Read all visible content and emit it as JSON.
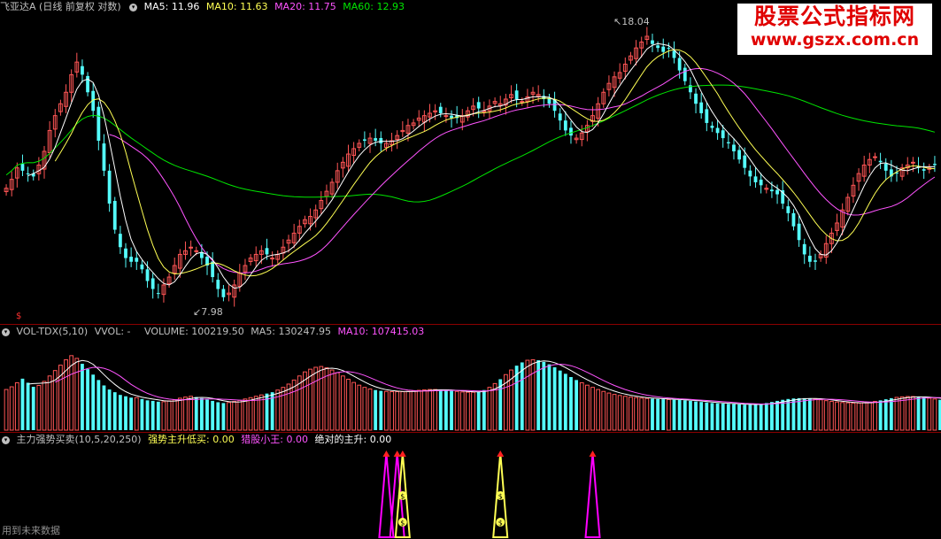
{
  "main": {
    "stock": "飞亚达A",
    "period": "(日线 前复权 对数)",
    "ma5": {
      "label": "MA5:",
      "value": "11.96",
      "color": "#ffffff"
    },
    "ma10": {
      "label": "MA10:",
      "value": "11.63",
      "color": "#ffff54"
    },
    "ma20": {
      "label": "MA20:",
      "value": "11.75",
      "color": "#ff54ff"
    },
    "ma60": {
      "label": "MA60:",
      "value": "12.93",
      "color": "#00e600"
    },
    "high_label": "18.04",
    "low_label": "7.98",
    "side_marker": "$"
  },
  "volume": {
    "name": "VOL-TDX(5,10)",
    "vvol": "VVOL: -",
    "vol": {
      "label": "VOLUME:",
      "value": "100219.50"
    },
    "ma5": {
      "label": "MA5:",
      "value": "130247.95"
    },
    "ma10": {
      "label": "MA10:",
      "value": "107415.03",
      "color": "#ff54ff"
    }
  },
  "indicator": {
    "name": "主力强势买卖(10,5,20,250)",
    "s1": {
      "label": "强势主升低买:",
      "value": "0.00",
      "color": "#ffff54"
    },
    "s2": {
      "label": "猎股小王:",
      "value": "0.00",
      "color": "#ff54ff"
    },
    "s3": {
      "label": "绝对的主升:",
      "value": "0.00",
      "color": "#ffffff"
    },
    "coin_glyph": "$"
  },
  "footer": "用到未来数据",
  "watermark": {
    "line1": "股票公式指标网",
    "line2": "www.gszx.com.cn"
  },
  "colors": {
    "up": "#ff5555",
    "down": "#54fcfc",
    "ma5": "#ffffff",
    "ma10": "#ffff54",
    "ma20": "#ff54ff",
    "ma60": "#00e600",
    "vma5": "#ffffff",
    "vma10": "#ff54ff",
    "signal_yellow": "#ffff54",
    "signal_magenta": "#ff00ff"
  },
  "chart_data": [
    {
      "type": "candlestick",
      "title": "飞亚达A (日线 前复权 对数)",
      "scale": "log",
      "ylim": [
        7.6,
        18.6
      ],
      "annotations": [
        {
          "text": "18.04",
          "value": 18.04,
          "index": 134
        },
        {
          "text": "7.98",
          "value": 7.98,
          "index": 41
        }
      ],
      "close": [
        11.2,
        11.5,
        11.9,
        11.8,
        11.7,
        11.6,
        12.0,
        12.5,
        13.3,
        13.9,
        14.4,
        14.9,
        15.7,
        16.3,
        15.7,
        14.9,
        14.1,
        12.9,
        11.8,
        10.7,
        9.9,
        9.4,
        9.1,
        9.0,
        9.0,
        8.8,
        8.5,
        8.3,
        8.2,
        8.4,
        8.6,
        8.9,
        9.2,
        9.3,
        9.4,
        9.3,
        9.1,
        8.9,
        8.6,
        8.3,
        8.1,
        8.2,
        8.4,
        8.7,
        8.9,
        9.1,
        9.2,
        9.3,
        9.2,
        9.1,
        9.2,
        9.4,
        9.6,
        9.8,
        10.0,
        10.2,
        10.3,
        10.5,
        10.8,
        11.1,
        11.4,
        11.8,
        12.1,
        12.4,
        12.6,
        12.8,
        12.9,
        13.0,
        12.9,
        12.8,
        12.8,
        12.9,
        13.1,
        13.3,
        13.5,
        13.6,
        13.8,
        13.9,
        14.0,
        14.1,
        14.0,
        13.9,
        13.8,
        13.8,
        13.9,
        14.1,
        14.3,
        14.2,
        14.1,
        14.3,
        14.5,
        14.4,
        14.6,
        14.8,
        14.6,
        14.5,
        14.7,
        14.9,
        14.8,
        14.6,
        14.4,
        14.1,
        13.7,
        13.3,
        13.1,
        13.0,
        13.2,
        13.5,
        13.9,
        14.4,
        14.9,
        15.3,
        15.6,
        15.8,
        16.2,
        16.6,
        17.0,
        17.3,
        17.6,
        17.2,
        17.0,
        16.8,
        17.0,
        16.5,
        15.9,
        15.4,
        14.9,
        14.4,
        14.0,
        13.6,
        13.4,
        13.2,
        13.0,
        12.8,
        12.5,
        12.2,
        11.9,
        11.6,
        11.4,
        11.3,
        11.2,
        11.1,
        11.0,
        10.7,
        10.4,
        10.0,
        9.6,
        9.2,
        9.0,
        9.0,
        9.2,
        9.5,
        9.8,
        10.1,
        10.5,
        10.9,
        11.3,
        11.7,
        12.0,
        12.2,
        12.3,
        12.1,
        11.8,
        11.6,
        11.7,
        11.9,
        12.0,
        12.1,
        11.9,
        11.8,
        11.9,
        12.0
      ]
    },
    {
      "type": "bar",
      "title": "VOL-TDX(5,10)",
      "ylim": [
        0,
        330000
      ],
      "values": [
        150000,
        160000,
        175000,
        190000,
        175000,
        160000,
        165000,
        180000,
        200000,
        220000,
        240000,
        260000,
        275000,
        265000,
        245000,
        225000,
        205000,
        185000,
        165000,
        150000,
        140000,
        130000,
        125000,
        120000,
        120000,
        115000,
        110000,
        108000,
        105000,
        105000,
        108000,
        112000,
        118000,
        122000,
        125000,
        122000,
        118000,
        113000,
        108000,
        103000,
        100000,
        102000,
        106000,
        110000,
        115000,
        120000,
        125000,
        130000,
        135000,
        140000,
        148000,
        158000,
        170000,
        185000,
        200000,
        215000,
        225000,
        232000,
        235000,
        230000,
        222000,
        212000,
        200000,
        188000,
        176000,
        166000,
        158000,
        152000,
        148000,
        145000,
        143000,
        142000,
        142000,
        142000,
        143000,
        145000,
        147000,
        149000,
        150000,
        150000,
        149000,
        147000,
        145000,
        143000,
        141000,
        140000,
        140000,
        142000,
        148000,
        158000,
        172000,
        188000,
        205000,
        222000,
        238000,
        250000,
        258000,
        260000,
        258000,
        252000,
        243000,
        232000,
        220000,
        208000,
        196000,
        185000,
        175000,
        166000,
        158000,
        150000,
        143000,
        137000,
        132000,
        128000,
        125000,
        122000,
        120000,
        118000,
        117000,
        116000,
        115000,
        114000,
        113000,
        112000,
        111000,
        110000,
        108000,
        106000,
        104000,
        102000,
        100000,
        99000,
        98000,
        97000,
        96000,
        95000,
        94000,
        94000,
        95000,
        97000,
        100000,
        104000,
        108000,
        112000,
        115000,
        117000,
        118000,
        118000,
        117000,
        115000,
        112000,
        109000,
        106000,
        104000,
        102000,
        101000,
        100000,
        100000,
        101000,
        103000,
        106000,
        110000,
        114000,
        118000,
        121000,
        123000,
        124000,
        124000,
        123000,
        121000,
        118000,
        115000,
        112000,
        110000,
        108000
      ]
    },
    {
      "type": "line",
      "title": "主力强势买卖(10,5,20,250)",
      "ylim": [
        0,
        1
      ],
      "signals": [
        {
          "name": "猎股小王",
          "index": 70
        },
        {
          "name": "猎股小王",
          "index": 72
        },
        {
          "name": "强势主升低买",
          "index": 73
        },
        {
          "name": "强势主升低买",
          "index": 91
        },
        {
          "name": "猎股小王",
          "index": 108
        },
        {
          "name": "猎股小王",
          "index": 248
        }
      ]
    }
  ]
}
